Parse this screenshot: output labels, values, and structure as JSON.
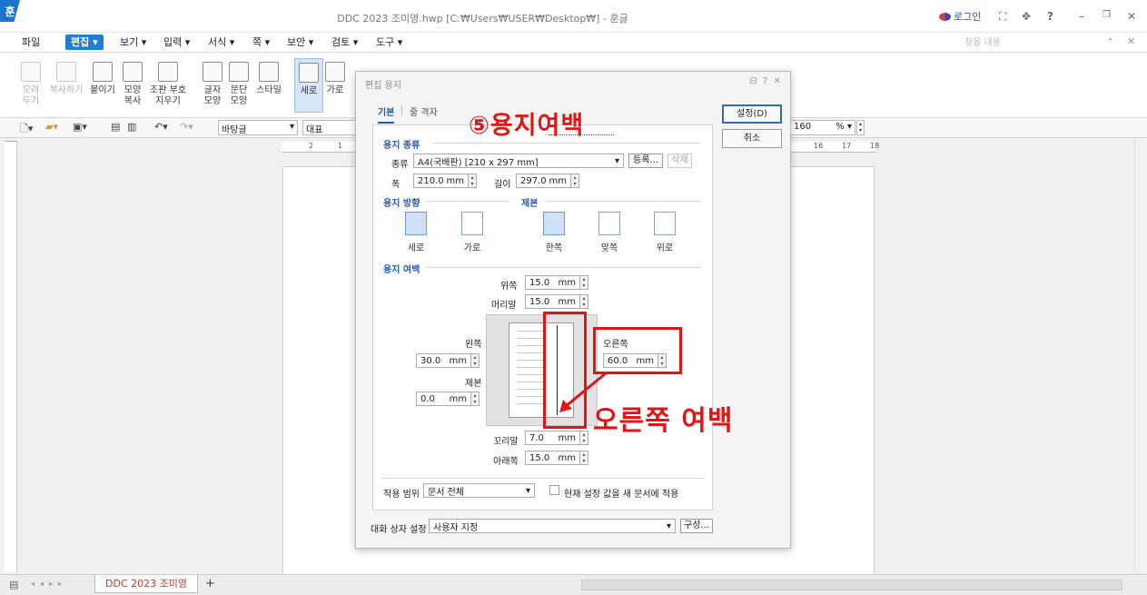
{
  "app": {
    "logo": "훈",
    "window_title": "DDC 2023 조미영.hwp [C:₩Users₩USER₩Desktop₩] - 훈글",
    "login_label": "로그인",
    "help_label": "?"
  },
  "menubar": {
    "items": [
      "파일",
      "편집",
      "보기",
      "입력",
      "서식",
      "쪽",
      "보안",
      "검토",
      "도구"
    ],
    "active": "편집",
    "search_placeholder": "찾을 내용"
  },
  "ribbon": {
    "buttons": [
      {
        "label": "오려\n두기",
        "enabled": false
      },
      {
        "label": "복사하기",
        "enabled": false
      },
      {
        "label": "붙이기",
        "enabled": true
      },
      {
        "label": "모양\n복사",
        "enabled": true
      },
      {
        "label": "조판 부호\n지우기",
        "enabled": true
      },
      {
        "label": "글자\n모양",
        "enabled": true
      },
      {
        "label": "문단\n모양",
        "enabled": true
      },
      {
        "label": "스타일",
        "enabled": true
      },
      {
        "label": "세로",
        "enabled": true,
        "selected": true
      },
      {
        "label": "가로",
        "enabled": true
      }
    ]
  },
  "toolbar": {
    "style_select": "바탕글",
    "font_select": "대표",
    "zoom_value": "160",
    "zoom_unit": "%"
  },
  "ruler": {
    "ticks": [
      "2",
      "1",
      "16",
      "17",
      "18"
    ]
  },
  "dialog": {
    "title": "편집 용지",
    "tabs": [
      "기본",
      "줄 격자"
    ],
    "active_tab": "기본",
    "buttons": {
      "ok": "설정(D)",
      "cancel": "취소"
    },
    "paper_type": {
      "header": "용지 종류",
      "type_label": "종류",
      "type_value": "A4(국배판) [210 x 297 mm]",
      "register": "등록...",
      "delete": "삭제",
      "width_label": "폭",
      "width_value": "210.0",
      "length_label": "길이",
      "length_value": "297.0",
      "unit": "mm"
    },
    "orientation": {
      "header": "용지 방향",
      "options": [
        "세로",
        "가로"
      ],
      "selected": "세로"
    },
    "binding": {
      "header": "제본",
      "options": [
        "한쪽",
        "맞쪽",
        "위로"
      ],
      "selected": "한쪽"
    },
    "margins": {
      "header": "용지 여백",
      "top_label": "위쪽",
      "top_value": "15.0",
      "header_label": "머리말",
      "header_value": "15.0",
      "left_label": "왼쪽",
      "left_value": "30.0",
      "gutter_label": "제본",
      "gutter_value": "0.0",
      "right_label": "오른쪽",
      "right_value": "60.0",
      "footer_label": "꼬리말",
      "footer_value": "7.0",
      "bottom_label": "아래쪽",
      "bottom_value": "15.0",
      "unit": "mm"
    },
    "apply": {
      "label": "적용 범위",
      "value": "문서 전체",
      "checkbox_label": "현재 설정 값을 새 문서에 적용",
      "checked": false
    },
    "dialog_setting": {
      "label": "대화 상자 설정",
      "value": "사용자 지정",
      "button": "구성..."
    }
  },
  "annotations": {
    "step": "⑤용지여백",
    "right_margin": "오른쪽 여백",
    "color": "#e31414"
  },
  "status": {
    "doc_tab": "DDC 2023 조미영",
    "add_tab": "+"
  }
}
